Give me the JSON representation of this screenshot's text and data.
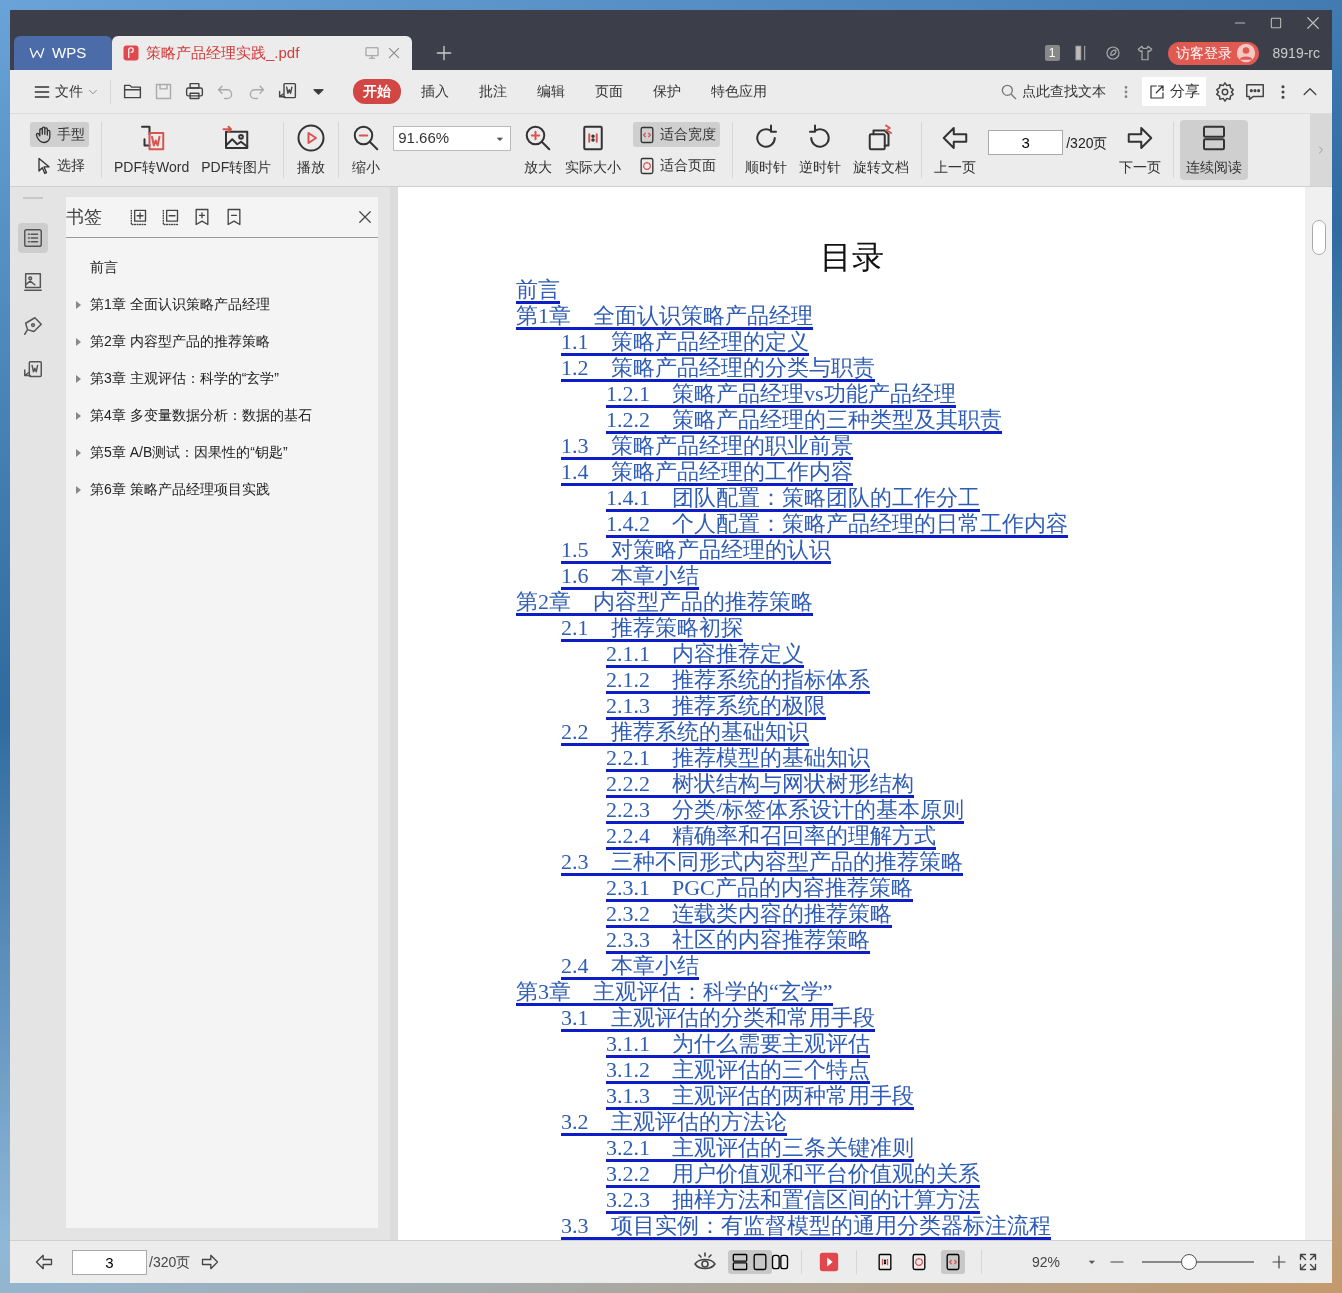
{
  "tabs": [
    {
      "label": "WPS",
      "kind": "home",
      "selected": false
    },
    {
      "label": "策略产品经理实践_.pdf",
      "kind": "document",
      "selected": true
    }
  ],
  "title_bar": {
    "window_count": "1",
    "login_button": "访客登录",
    "user": "8919-rc"
  },
  "menu": {
    "file": "文件",
    "search": "点此查找文本",
    "share": "分享",
    "tabs": [
      {
        "label": "开始",
        "selected": true
      },
      {
        "label": "插入",
        "selected": false
      },
      {
        "label": "批注",
        "selected": false
      },
      {
        "label": "编辑",
        "selected": false
      },
      {
        "label": "页面",
        "selected": false
      },
      {
        "label": "保护",
        "selected": false
      },
      {
        "label": "特色应用",
        "selected": false
      }
    ]
  },
  "toolbar": {
    "hand": {
      "label": "手型",
      "selected": true
    },
    "select": {
      "label": "选择",
      "selected": false
    },
    "pdf_to_word": "PDF转Word",
    "pdf_to_image": "PDF转图片",
    "play": "播放",
    "zoom_out": "缩小",
    "zoom_value": "91.66%",
    "zoom_in": "放大",
    "actual_size": "实际大小",
    "fit_width": {
      "label": "适合宽度",
      "selected": true
    },
    "fit_page": {
      "label": "适合页面",
      "selected": false
    },
    "clockwise": "顺时针",
    "counterclockwise": "逆时针",
    "rotate_document": "旋转文档",
    "prev_page": "上一页",
    "page": "3",
    "page_total": "/320页",
    "next_page": "下一页",
    "continuous": {
      "label": "连续阅读",
      "selected": true
    }
  },
  "sidebar": {
    "rail": [
      {
        "selected": true
      },
      {
        "selected": false
      },
      {
        "selected": false
      },
      {
        "selected": false
      }
    ],
    "title": "书签",
    "bookmarks": [
      {
        "label": "前言"
      },
      {
        "label": "第1章 全面认识策略产品经理",
        "expanded": false
      },
      {
        "label": "第2章 内容型产品的推荐策略",
        "expanded": false
      },
      {
        "label": "第3章 主观评估：科学的“玄学”",
        "expanded": false
      },
      {
        "label": "第4章 多变量数据分析：数据的基石",
        "expanded": false
      },
      {
        "label": "第5章 A/B测试：因果性的“钥匙”",
        "expanded": false
      },
      {
        "label": "第6章 策略产品经理项目实践",
        "expanded": false
      }
    ]
  },
  "document": {
    "heading": "目录",
    "toc": [
      {
        "label": "前言"
      },
      {
        "label": "第1章　全面认识策略产品经理",
        "children": [
          {
            "label": "1.1　策略产品经理的定义"
          },
          {
            "label": "1.2　策略产品经理的分类与职责",
            "children": [
              {
                "label": "1.2.1　策略产品经理vs功能产品经理"
              },
              {
                "label": "1.2.2　策略产品经理的三种类型及其职责"
              }
            ]
          },
          {
            "label": "1.3　策略产品经理的职业前景"
          },
          {
            "label": "1.4　策略产品经理的工作内容",
            "children": [
              {
                "label": "1.4.1　团队配置：策略团队的工作分工"
              },
              {
                "label": "1.4.2　个人配置：策略产品经理的日常工作内容"
              }
            ]
          },
          {
            "label": "1.5　对策略产品经理的认识"
          },
          {
            "label": "1.6　本章小结"
          }
        ]
      },
      {
        "label": "第2章　内容型产品的推荐策略",
        "children": [
          {
            "label": "2.1　推荐策略初探",
            "children": [
              {
                "label": "2.1.1　内容推荐定义"
              },
              {
                "label": "2.1.2　推荐系统的指标体系"
              },
              {
                "label": "2.1.3　推荐系统的极限"
              }
            ]
          },
          {
            "label": "2.2　推荐系统的基础知识",
            "children": [
              {
                "label": "2.2.1　推荐模型的基础知识"
              },
              {
                "label": "2.2.2　树状结构与网状树形结构"
              },
              {
                "label": "2.2.3　分类/标签体系设计的基本原则"
              },
              {
                "label": "2.2.4　精确率和召回率的理解方式"
              }
            ]
          },
          {
            "label": "2.3　三种不同形式内容型产品的推荐策略",
            "children": [
              {
                "label": "2.3.1　PGC产品的内容推荐策略"
              },
              {
                "label": "2.3.2　连载类内容的推荐策略"
              },
              {
                "label": "2.3.3　社区的内容推荐策略"
              }
            ]
          },
          {
            "label": "2.4　本章小结"
          }
        ]
      },
      {
        "label": "第3章　主观评估：科学的“玄学”",
        "children": [
          {
            "label": "3.1　主观评估的分类和常用手段",
            "children": [
              {
                "label": "3.1.1　为什么需要主观评估"
              },
              {
                "label": "3.1.2　主观评估的三个特点"
              },
              {
                "label": "3.1.3　主观评估的两种常用手段"
              }
            ]
          },
          {
            "label": "3.2　主观评估的方法论",
            "children": [
              {
                "label": "3.2.1　主观评估的三条关键准则"
              },
              {
                "label": "3.2.2　用户价值观和平台价值观的关系"
              },
              {
                "label": "3.2.3　抽样方法和置信区间的计算方法"
              }
            ]
          },
          {
            "label": "3.3　项目实例：有监督模型的通用分类器标注流程"
          }
        ]
      }
    ]
  },
  "status_bar": {
    "page": "3",
    "page_total": "/320页",
    "views": [
      {
        "selected": true
      },
      {
        "selected": true
      },
      {
        "selected": false
      }
    ],
    "fits": [
      {
        "selected": false
      },
      {
        "selected": false
      },
      {
        "selected": true
      }
    ],
    "zoom": "92%",
    "zoom_slider": {
      "level": 0.42
    }
  }
}
